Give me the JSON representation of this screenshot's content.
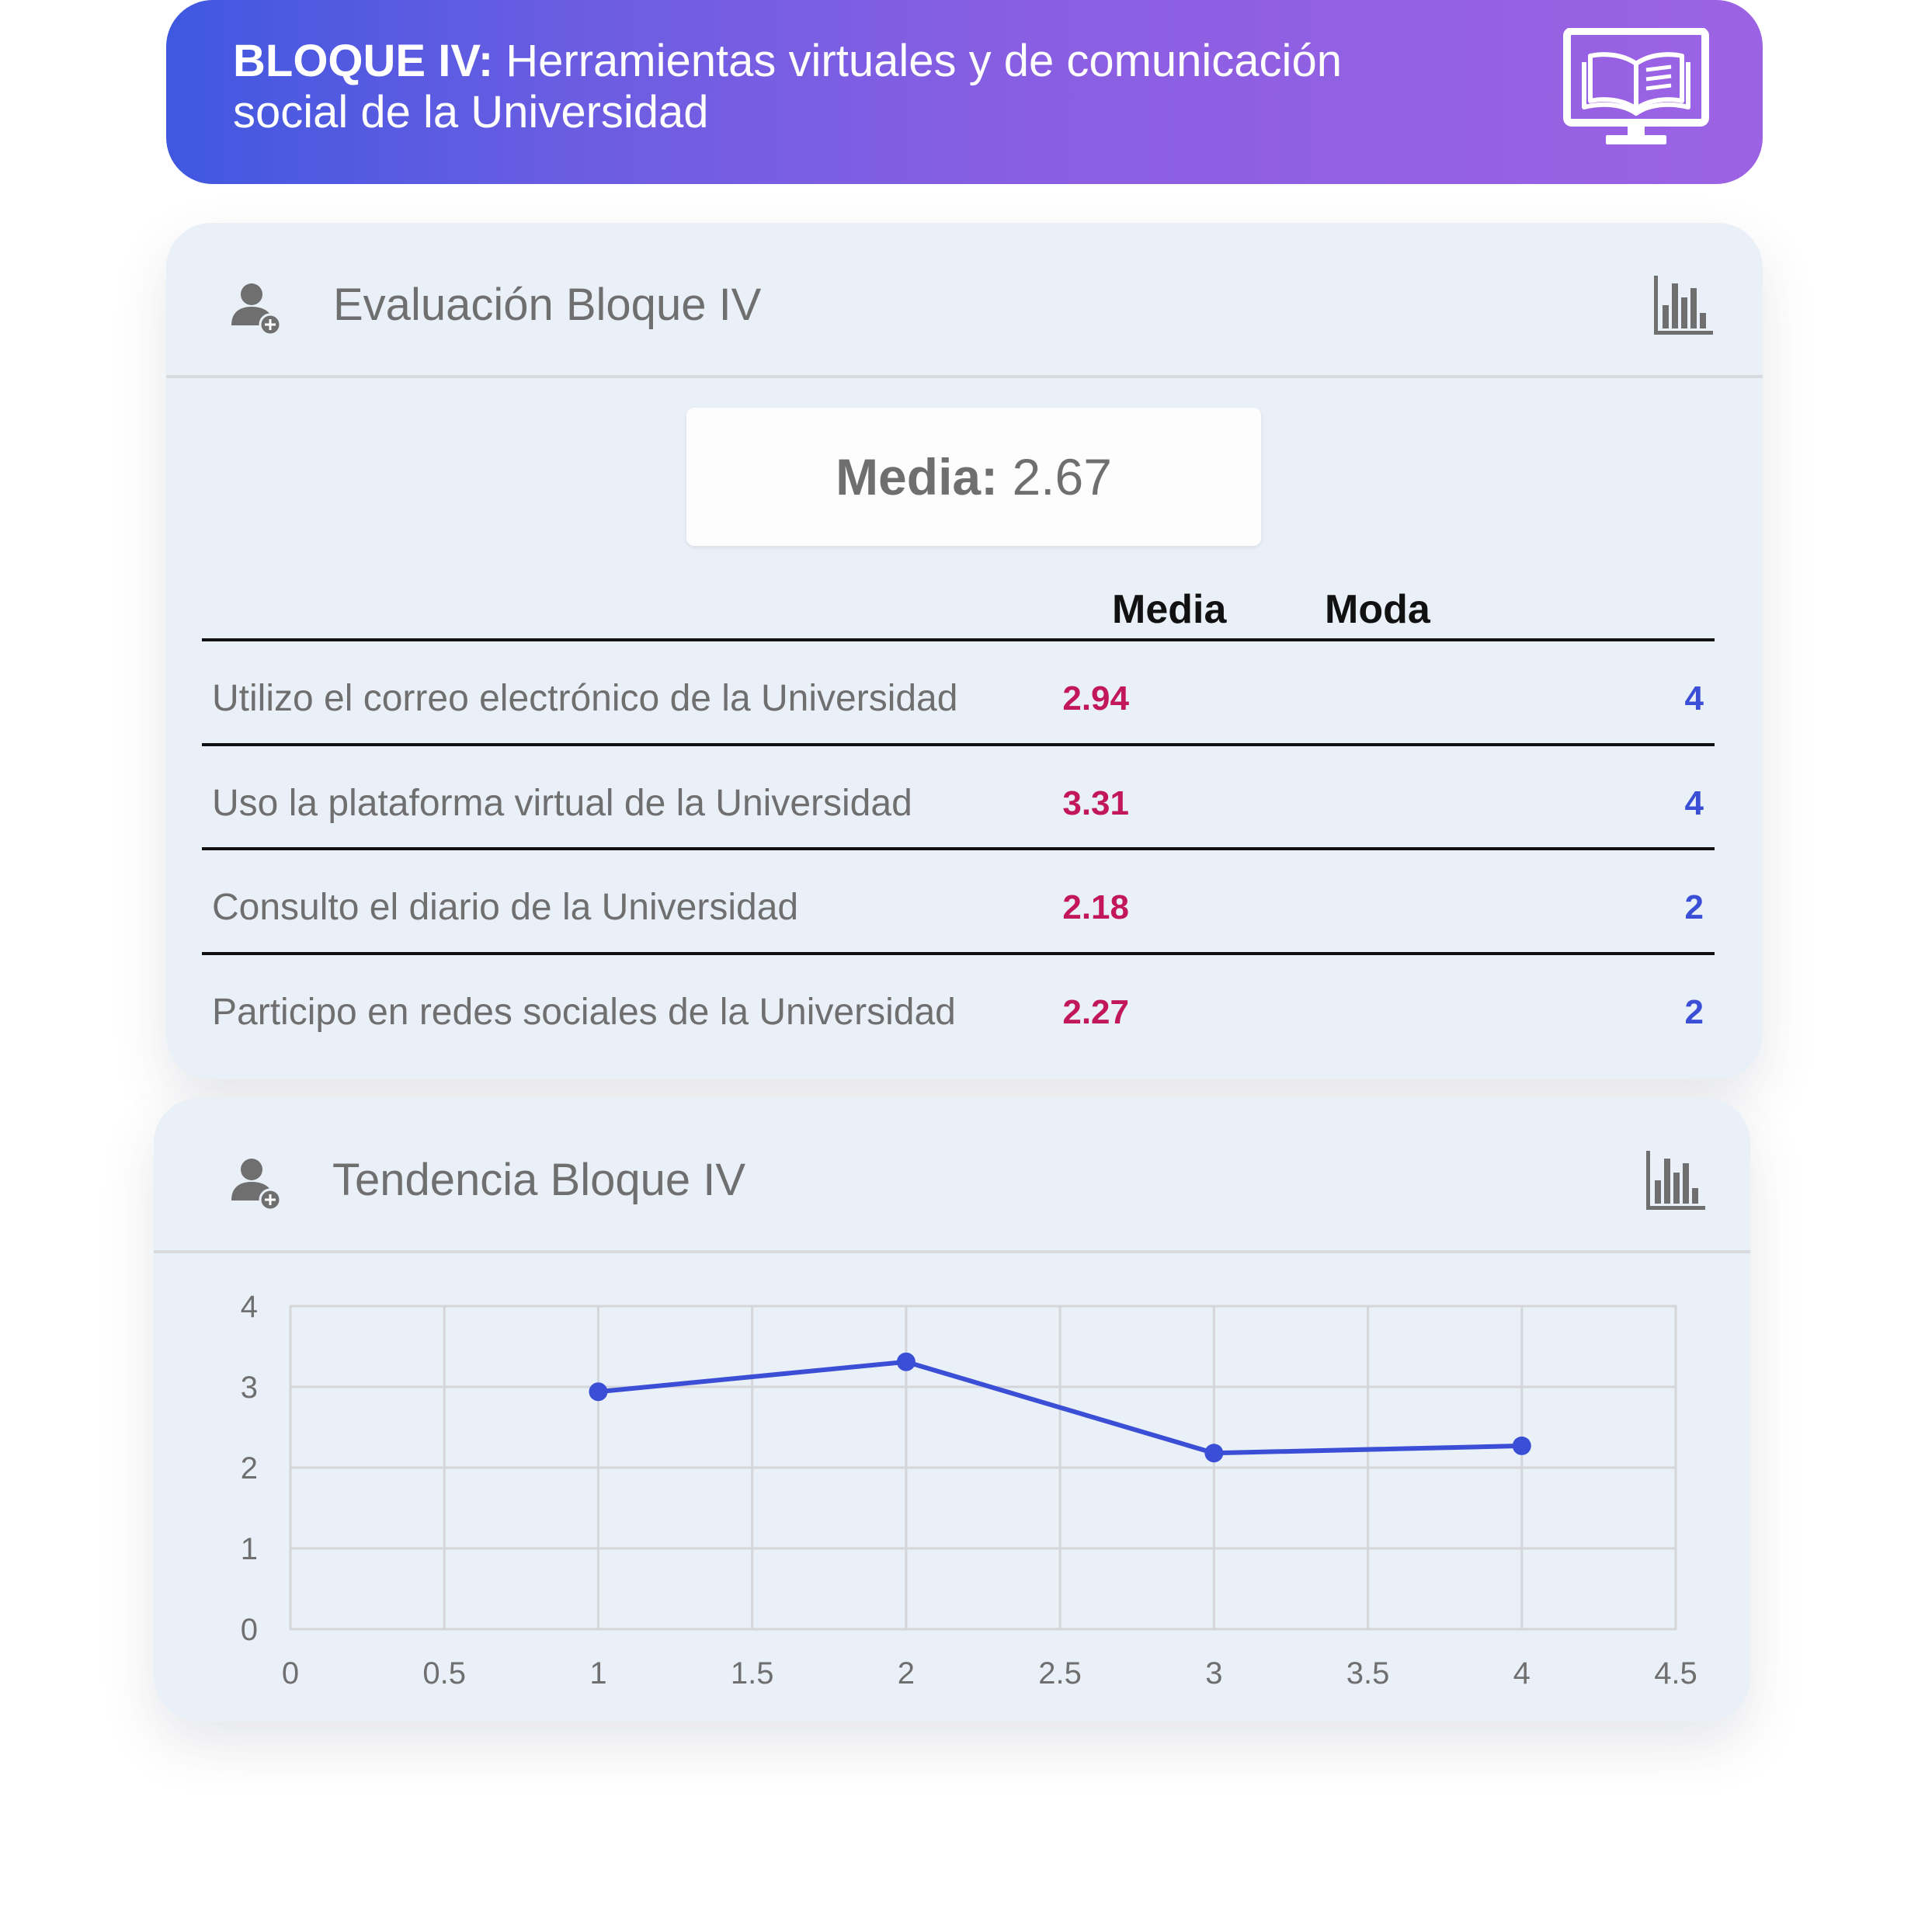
{
  "banner": {
    "title_bold": "BLOQUE IV:",
    "title_line1": " Herramientas virtuales y de comunicación",
    "title_line2": "social de la Universidad",
    "icon": "book-monitor-icon"
  },
  "evaluation_card": {
    "title": "Evaluación Bloque IV",
    "user_icon": "user-add-icon",
    "chart_icon": "bar-chart-icon",
    "summary_label": "Media:",
    "summary_value": "2.67",
    "columns": {
      "media": "Media",
      "moda": "Moda"
    },
    "rows": [
      {
        "label": "Utilizo el correo electrónico de la Universidad",
        "media": "2.94",
        "moda": "4"
      },
      {
        "label": "Uso la plataforma virtual de la Universidad",
        "media": "3.31",
        "moda": "4"
      },
      {
        "label": "Consulto el diario de la Universidad",
        "media": "2.18",
        "moda": "2"
      },
      {
        "label": "Participo en redes sociales de la Universidad",
        "media": "2.27",
        "moda": "2"
      }
    ],
    "colors": {
      "media": "#c2185b",
      "moda": "#3b4fd6"
    }
  },
  "trend_card": {
    "title": "Tendencia Bloque IV",
    "user_icon": "user-add-icon",
    "chart_icon": "bar-chart-icon"
  },
  "chart_data": {
    "type": "line",
    "title": "",
    "xlabel": "",
    "ylabel": "",
    "xlim": [
      0,
      4.5
    ],
    "ylim": [
      0,
      4
    ],
    "x_ticks": [
      "0",
      "0.5",
      "1",
      "1.5",
      "2",
      "2.5",
      "3",
      "3.5",
      "4",
      "4.5"
    ],
    "y_ticks": [
      "0",
      "1",
      "2",
      "3",
      "4"
    ],
    "grid": true,
    "series": [
      {
        "x": [
          1,
          2,
          3,
          4
        ],
        "y": [
          2.94,
          3.31,
          2.18,
          2.27
        ],
        "color": "#3b4fd6"
      }
    ]
  }
}
